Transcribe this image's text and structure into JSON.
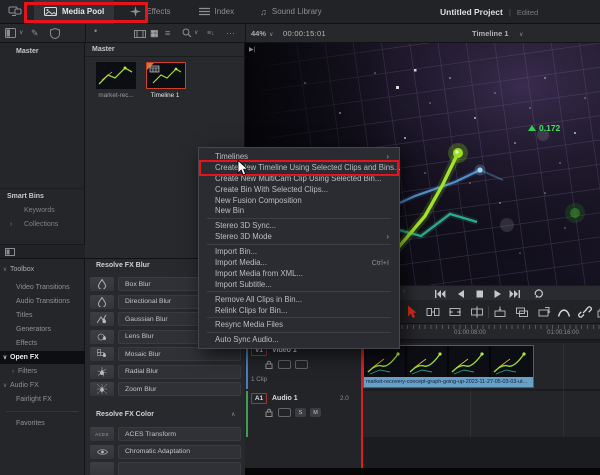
{
  "topbar": {
    "tabs": [
      {
        "label": "Media Pool"
      },
      {
        "label": "Effects"
      },
      {
        "label": "Index"
      },
      {
        "label": "Sound Library"
      }
    ],
    "project_title": "Untitled Project",
    "project_status": "Edited"
  },
  "media_toolbar": {
    "zoom_value": "44%",
    "timecode": "00:00:15:01"
  },
  "viewer": {
    "header_timeline": "Timeline 1",
    "overlay_change": "0.172"
  },
  "bins": {
    "root_label": "Master",
    "smart_bins_label": "Smart Bins",
    "items": [
      {
        "label": "Keywords"
      },
      {
        "label": "Collections"
      }
    ]
  },
  "media_pool": {
    "header": "Master",
    "clips": [
      {
        "label": "market-rec..."
      },
      {
        "label": "Timeline 1"
      }
    ]
  },
  "effects_nav": {
    "items": [
      {
        "label": "Toolbox"
      },
      {
        "label": "Video Transitions"
      },
      {
        "label": "Audio Transitions"
      },
      {
        "label": "Titles"
      },
      {
        "label": "Generators"
      },
      {
        "label": "Effects"
      },
      {
        "label": "Open FX"
      },
      {
        "label": "Filters"
      },
      {
        "label": "Audio FX"
      },
      {
        "label": "Fairlight FX"
      },
      {
        "label": "Favorites"
      }
    ]
  },
  "fx_panel": {
    "sections": [
      {
        "title": "Resolve FX Blur",
        "items": [
          "Box Blur",
          "Directional Blur",
          "Gaussian Blur",
          "Lens Blur",
          "Mosaic Blur",
          "Radial Blur",
          "Zoom Blur"
        ]
      },
      {
        "title": "Resolve FX Color",
        "items": [
          "ACES Transform",
          "Chromatic Adaptation"
        ]
      }
    ],
    "aces_icon_text": "ACES"
  },
  "context_menu": {
    "items": [
      {
        "label": "Timelines"
      },
      {
        "label": "Create New Timeline Using Selected Clips and Bins..."
      },
      {
        "label": "Create New MultiCam Clip Using Selected Bin..."
      },
      {
        "label": "Create Bin With Selected Clips..."
      },
      {
        "label": "New Fusion Composition"
      },
      {
        "label": "New Bin"
      },
      {
        "label": "Stereo 3D Sync..."
      },
      {
        "label": "Stereo 3D Mode"
      },
      {
        "label": "Import Bin..."
      },
      {
        "label": "Import Media...",
        "shortcut": "Ctrl+I"
      },
      {
        "label": "Import Media from XML..."
      },
      {
        "label": "Import Subtitle..."
      },
      {
        "label": "Remove All Clips in Bin..."
      },
      {
        "label": "Relink Clips for Bin..."
      },
      {
        "label": "Resync Media Files"
      },
      {
        "label": "Auto Sync Audio..."
      }
    ]
  },
  "timeline": {
    "ruler_labels": [
      "01:00:08:00",
      "01:00:16:00"
    ],
    "video_track": {
      "id": "V1",
      "name": "Video 1",
      "info": "1 Clip"
    },
    "audio_track": {
      "id": "A1",
      "name": "Audio 1",
      "level": "2.0",
      "solo": "S",
      "mute": "M"
    },
    "clip_name": "market-recovery-concept-graph-going-up-2023-11-27-05-03-03-ut..."
  },
  "icons": {
    "chevron_down": "∨",
    "chevron_right": "›",
    "collapse_up": "∧",
    "dots": "···",
    "pen": "✎",
    "grid": "▦",
    "list": "≡",
    "music": "♫",
    "sort": "≡↓",
    "pipe": "|",
    "flag": "▶|",
    "slider_dot": "•"
  },
  "colors": {
    "annotation_red": "#e7131c",
    "clip_label_blue": "#69a0c8",
    "video_accent": "#4a7fbf",
    "audio_accent": "#3f9e4f",
    "line_green": "#a4e426",
    "line_blue": "#3f7fc4",
    "line_teal": "#2fbf9a"
  }
}
